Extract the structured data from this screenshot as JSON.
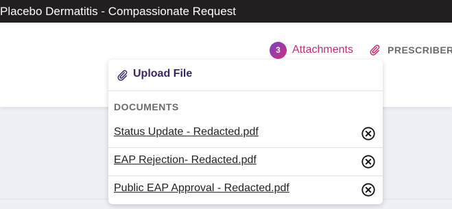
{
  "window": {
    "title": "Placebo Dermatitis - Compassionate Request"
  },
  "header": {
    "attachments_count": "3",
    "attachments_label": "Attachments",
    "prescriber_label": "PRESCRIBER"
  },
  "dropdown": {
    "upload_label": "Upload File",
    "section_title": "DOCUMENTS",
    "documents": [
      {
        "name": "Status Update - Redacted.pdf"
      },
      {
        "name": "EAP Rejection- Redacted.pdf"
      },
      {
        "name": "Public EAP Approval - Redacted.pdf"
      }
    ]
  },
  "colors": {
    "titlebar_bg": "#231f20",
    "accent_pink": "#c42c70",
    "badge_gradient_start": "#7b3fc9",
    "badge_gradient_end": "#d0307a",
    "upload_text": "#3a2666"
  },
  "icons": {
    "header_attach": "paperclip-icon",
    "upload": "paperclip-icon",
    "remove": "close-circle-icon"
  }
}
